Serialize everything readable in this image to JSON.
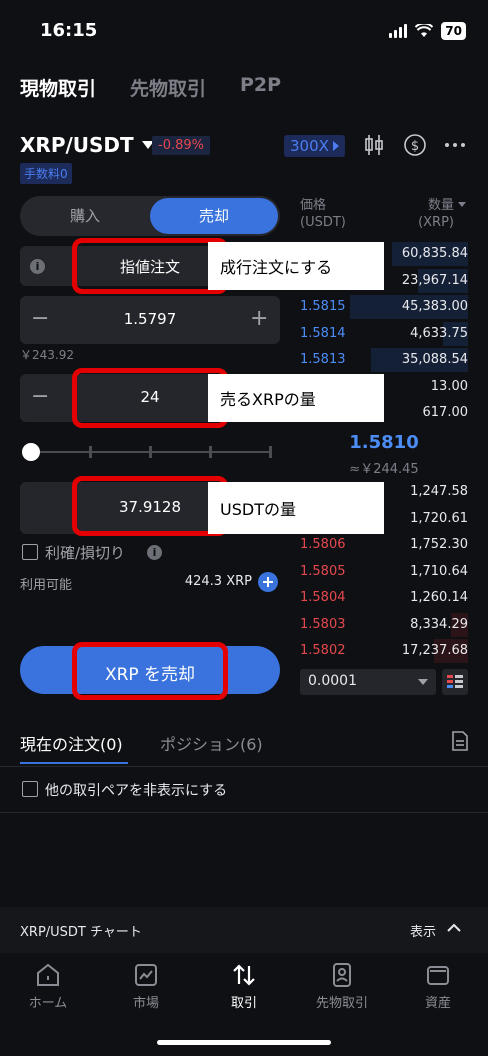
{
  "status_bar": {
    "time": "16:15",
    "battery": "70"
  },
  "top_tabs": [
    {
      "label": "現物取引",
      "active": true
    },
    {
      "label": "先物取引",
      "active": false
    },
    {
      "label": "P2P",
      "active": false
    }
  ],
  "pair": {
    "symbol": "XRP/USDT",
    "change": "-0.89%",
    "fee_badge": "手数料0",
    "leverage": "300X"
  },
  "trade_toggle": {
    "buy": "購入",
    "sell": "売却"
  },
  "order_type": {
    "label": "指値注文",
    "annotation": "成行注文にする"
  },
  "price_field": {
    "value": "1.5797",
    "sub": "￥243.92"
  },
  "amount_field": {
    "value": "24",
    "annotation": "売るXRPの量"
  },
  "total_field": {
    "value": "37.9128",
    "annotation": "USDTの量"
  },
  "tpsl": {
    "label": "利確/損切り"
  },
  "available": {
    "label": "利用可能",
    "value": "424.3 XRP"
  },
  "sell_button": {
    "label": "XRP を売却"
  },
  "order_book": {
    "header_price": "価格\n(USDT)",
    "header_qty": "数量\n(XRP)",
    "top_rows": [
      {
        "price": "",
        "qty": "60,835.84",
        "bar": 0.45
      },
      {
        "price": "",
        "qty": "23,967.14",
        "bar": 0.3
      },
      {
        "price": "1.5815",
        "qty": "45,383.00",
        "bar": 0.7
      },
      {
        "price": "1.5814",
        "qty": "4,633.75",
        "bar": 0.15
      },
      {
        "price": "1.5813",
        "qty": "35,088.54",
        "bar": 0.58
      },
      {
        "price": "",
        "qty": "13.00",
        "bar": 0.0
      },
      {
        "price": "",
        "qty": "617.00",
        "bar": 0.0
      }
    ],
    "mid_price": "1.5810",
    "mid_sub": "≈￥244.45",
    "bottom_rows": [
      {
        "price": "",
        "qty": "1,247.58",
        "bar": 0.0
      },
      {
        "price": "",
        "qty": "1,720.61",
        "bar": 0.0
      },
      {
        "price": "1.5806",
        "qty": "1,752.30",
        "bar": 0.0
      },
      {
        "price": "1.5805",
        "qty": "1,710.64",
        "bar": 0.0
      },
      {
        "price": "1.5804",
        "qty": "1,260.14",
        "bar": 0.0
      },
      {
        "price": "1.5803",
        "qty": "8,334.29",
        "bar": 0.1
      },
      {
        "price": "1.5802",
        "qty": "17,237.68",
        "bar": 0.2
      }
    ],
    "step": "0.0001"
  },
  "order_tabs": [
    {
      "label": "現在の注文(0)",
      "active": true
    },
    {
      "label": "ポジション(6)",
      "active": false
    }
  ],
  "hide_pairs": {
    "label": "他の取引ペアを非表示にする"
  },
  "chart_bar": {
    "label": "XRP/USDT チャート",
    "toggle": "表示"
  },
  "bottom_nav": [
    {
      "label": "ホーム",
      "icon": "home-icon"
    },
    {
      "label": "市場",
      "icon": "chart-icon"
    },
    {
      "label": "取引",
      "icon": "trade-icon"
    },
    {
      "label": "先物取引",
      "icon": "futures-icon"
    },
    {
      "label": "資産",
      "icon": "wallet-icon"
    }
  ],
  "colors": {
    "accent": "#3a73dd",
    "down": "#e5484d",
    "up": "#4c8df6",
    "highlight": "#e40000"
  }
}
